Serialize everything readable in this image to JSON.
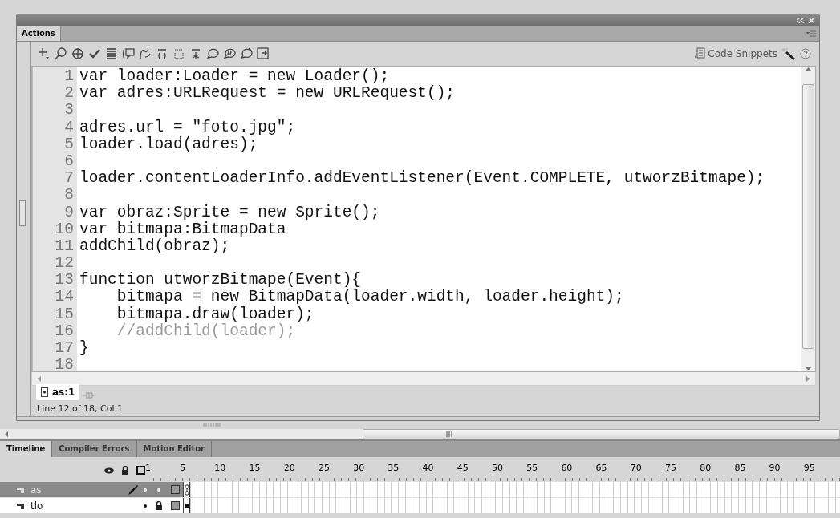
{
  "actions_panel": {
    "tab": {
      "label": "Actions",
      "selected": true
    },
    "code_snippets": "Code Snippets",
    "lines": [
      {
        "number": "1",
        "kind": "code",
        "text": "var loader:Loader = new Loader();"
      },
      {
        "number": "2",
        "kind": "code",
        "text": "var adres:URLRequest = new URLRequest();"
      },
      {
        "number": "3"
      },
      {
        "number": "4",
        "kind": "code",
        "text": "adres.url = \"foto.jpg\";"
      },
      {
        "number": "5",
        "kind": "code",
        "text": "loader.load(adres);"
      },
      {
        "number": "6"
      },
      {
        "number": "7",
        "kind": "code",
        "text": "loader.contentLoaderInfo.addEventListener(Event.COMPLETE, utworzBitmape);"
      },
      {
        "number": "8"
      },
      {
        "number": "9",
        "kind": "code",
        "text": "var obraz:Sprite = new Sprite();"
      },
      {
        "number": "10",
        "kind": "code",
        "text": "var bitmapa:BitmapData"
      },
      {
        "number": "11",
        "kind": "code",
        "text": "addChild(obraz);"
      },
      {
        "number": "12"
      },
      {
        "number": "13",
        "kind": "code",
        "text": "function utworzBitmape(Event){"
      },
      {
        "number": "14",
        "kind": "code",
        "text": "    bitmapa = new BitmapData(loader.width, loader.height);"
      },
      {
        "number": "15",
        "kind": "code",
        "text": "    bitmapa.draw(loader);"
      },
      {
        "number": "16",
        "kind": "comment",
        "text": "    //addChild(loader);"
      },
      {
        "number": "17",
        "kind": "code",
        "text": "}"
      },
      {
        "number": "18"
      }
    ],
    "script_tab": {
      "label": "as:1",
      "selected": true
    },
    "status": "Line 12 of 18, Col 1"
  },
  "timeline": {
    "tabs": [
      {
        "label": "Timeline",
        "selected": true
      },
      {
        "label": "Compiler Errors",
        "selected": false
      },
      {
        "label": "Motion Editor",
        "selected": false
      }
    ],
    "frame_numbers": [
      "1",
      "5",
      "10",
      "15",
      "20",
      "25",
      "30",
      "35",
      "40",
      "45",
      "50",
      "55",
      "60",
      "65",
      "70",
      "75",
      "80",
      "85",
      "90",
      "95"
    ],
    "layers": [
      {
        "name": "as",
        "selected": true,
        "locked": false,
        "keyframe": {
          "kind": "actions"
        }
      },
      {
        "name": "tlo",
        "selected": false,
        "locked": true,
        "keyframe": {
          "kind": "filled"
        }
      }
    ]
  }
}
